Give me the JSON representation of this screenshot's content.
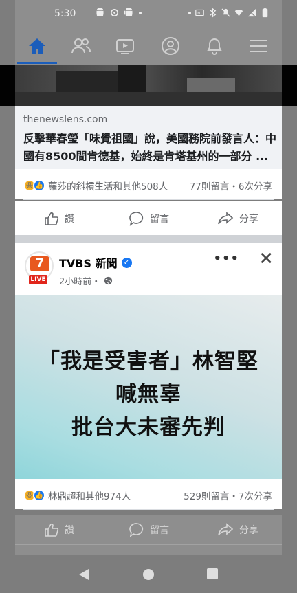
{
  "status_bar": {
    "time": "5:30"
  },
  "fb_nav": {
    "tabs": [
      {
        "name": "home",
        "icon": "home-icon",
        "active": true
      },
      {
        "name": "friends",
        "icon": "friends-icon"
      },
      {
        "name": "watch",
        "icon": "video-icon"
      },
      {
        "name": "profile",
        "icon": "profile-icon"
      },
      {
        "name": "notifications",
        "icon": "bell-icon"
      },
      {
        "name": "menu",
        "icon": "hamburger-icon"
      }
    ]
  },
  "post1": {
    "link_domain": "thenewslens.com",
    "link_title": "反擊華春瑩「味覺祖國」說，美國務院前發言人：中國有8500間肯德基，始終是肯塔基州的一部分 ...",
    "reactions_text": "蘿莎的斜槓生活和其他508人",
    "counts_text": "77則留言・6次分享",
    "actions": {
      "like": "讚",
      "comment": "留言",
      "share": "分享"
    }
  },
  "post2": {
    "page_name": "TVBS 新聞",
    "post_time": "2小時前・",
    "more_label": "•••",
    "close_label": "✕",
    "avatar_text": "7",
    "live_badge": "LIVE",
    "image_text": [
      "「我是受害者」林智堅",
      "喊無辜",
      "批台大未審先判"
    ],
    "reactions_text": "林鼎超和其他974人",
    "counts_text": "529則留言・7次分享",
    "actions": {
      "like": "讚",
      "comment": "留言",
      "share": "分享"
    }
  },
  "colors": {
    "fb_blue": "#1877f2",
    "dim_overlay": "#8e8e8e",
    "secondary_text": "#65676b"
  }
}
